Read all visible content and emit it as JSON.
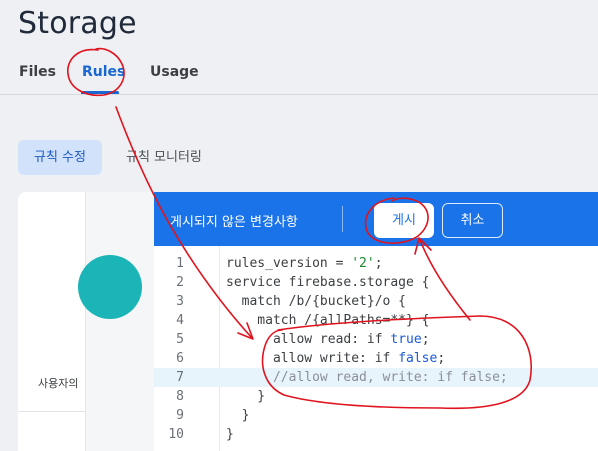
{
  "page": {
    "title": "Storage"
  },
  "tabs": [
    {
      "label": "Files"
    },
    {
      "label": "Rules",
      "selected": true
    },
    {
      "label": "Usage"
    }
  ],
  "chips": {
    "edit": "규칙 수정",
    "monitor": "규칙 모니터링"
  },
  "left_panel": {
    "label": "사용자의"
  },
  "publish_bar": {
    "message": "게시되지 않은 변경사항",
    "publish_label": "게시",
    "cancel_label": "취소",
    "color": "#1a73e8"
  },
  "editor": {
    "active_line": 7,
    "lines": [
      {
        "n": "1",
        "code": "rules_version = '2';"
      },
      {
        "n": "2",
        "code": "service firebase.storage {"
      },
      {
        "n": "3",
        "code": "  match /b/{bucket}/o {"
      },
      {
        "n": "4",
        "code": "    match /{allPaths=**} {"
      },
      {
        "n": "5",
        "code": "      allow read: if true;"
      },
      {
        "n": "6",
        "code": "      allow write: if false;"
      },
      {
        "n": "7",
        "code": "      //allow read, write: if false;"
      },
      {
        "n": "8",
        "code": "    }"
      },
      {
        "n": "9",
        "code": "  }"
      },
      {
        "n": "10",
        "code": "}"
      }
    ]
  },
  "annotation_color": "#e0141e"
}
